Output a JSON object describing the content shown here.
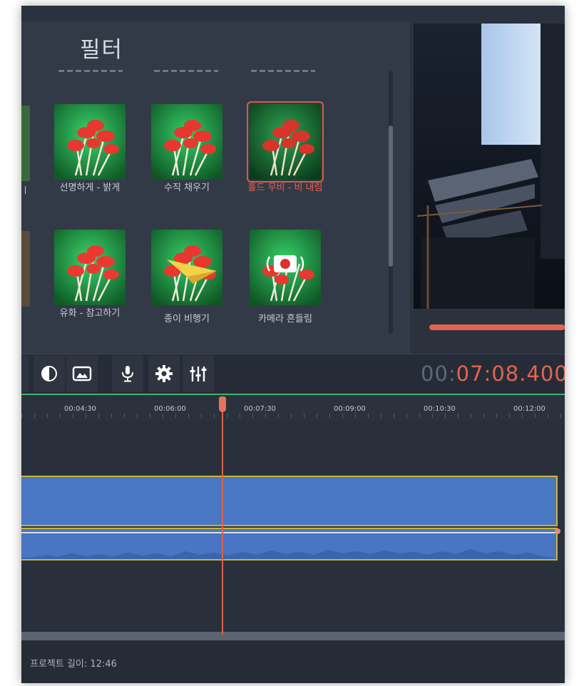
{
  "filter_panel": {
    "title": "필터",
    "items": [
      {
        "label": "선명하게 - 밝게",
        "icon": "mushroom-thumbnail",
        "selected": false
      },
      {
        "label": "수직 채우기",
        "icon": "mushroom-thumbnail",
        "selected": false
      },
      {
        "label": "홀드 무비 - 비 내림",
        "icon": "mushroom-thumbnail",
        "selected": true
      },
      {
        "label": "유화 - 참고하기",
        "icon": "mushroom-thumbnail",
        "selected": false
      },
      {
        "label": "종이 비행기",
        "icon": "paper-plane-thumbnail",
        "selected": false
      },
      {
        "label": "카메라 흔들림",
        "icon": "camera-shake-thumbnail",
        "selected": false
      }
    ]
  },
  "toolbar": {
    "tools": [
      "color-adjust-icon",
      "image-icon",
      "microphone-icon",
      "gear-icon",
      "equalizer-icon"
    ]
  },
  "timecode": {
    "prefix": "00:",
    "value": "07:08.400"
  },
  "timeline": {
    "ruler_ticks": [
      "00:04:30",
      "00:06:00",
      "00:07:30",
      "00:09:00",
      "00:10:30",
      "00:12:00"
    ]
  },
  "status": {
    "project_length": "프로젝트 길이: 12:46"
  },
  "colors": {
    "accent": "#e4644f",
    "clip_blue": "#4a77c4",
    "clip_border": "#c9b43a",
    "ruler_line": "#3eb36e"
  }
}
